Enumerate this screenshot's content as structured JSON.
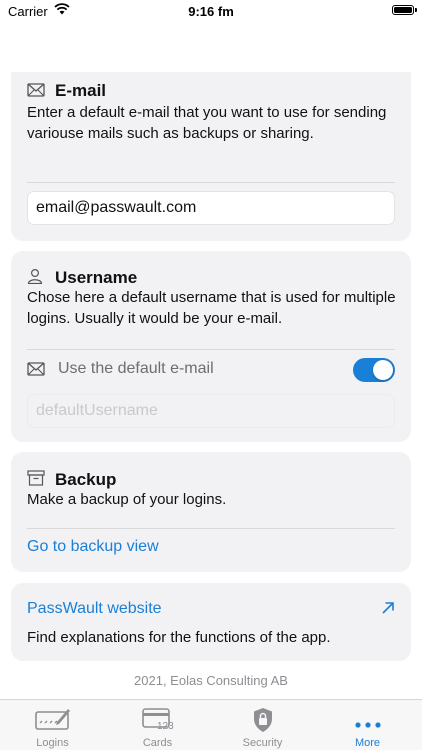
{
  "status_bar": {
    "carrier": "Carrier",
    "time": "9:16 fm"
  },
  "email_section": {
    "title": "E-mail",
    "description": "Enter a default e-mail that you want to use for sending variouse mails such as backups or sharing.",
    "input_value": "email@passwault.com"
  },
  "username_section": {
    "title": "Username",
    "description": "Chose here a default username that is used for multiple logins. Usually it would be your e-mail.",
    "toggle_label": "Use the default e-mail",
    "toggle_on": true,
    "input_placeholder": "defaultUsername"
  },
  "backup_section": {
    "title": "Backup",
    "description": "Make a backup of your logins.",
    "link": "Go to backup view"
  },
  "website_section": {
    "link": "PassWault website",
    "description": "Find explanations for the functions of the app."
  },
  "footer": "2021, Eolas Consulting AB",
  "tabs": [
    {
      "label": "Logins",
      "icon": "signature-icon"
    },
    {
      "label": "Cards",
      "icon": "card-icon"
    },
    {
      "label": "Security",
      "icon": "lock-shield-icon"
    },
    {
      "label": "More",
      "icon": "more-dots-icon"
    }
  ],
  "colors": {
    "accent": "#1a7fd6",
    "card_bg": "#f2f2f4",
    "muted": "#8e8e93"
  }
}
